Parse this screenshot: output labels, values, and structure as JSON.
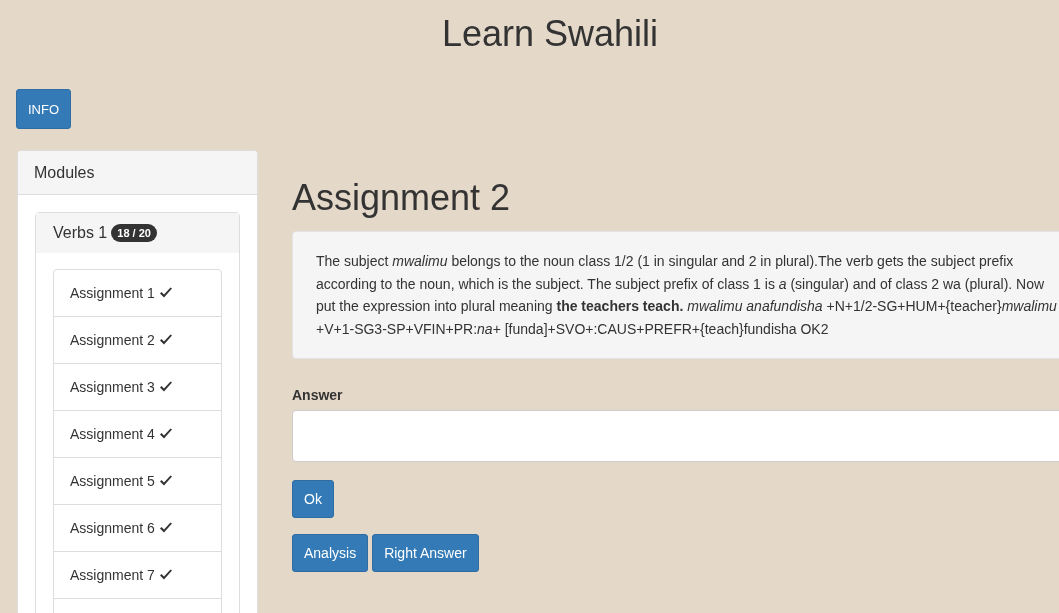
{
  "header": {
    "title": "Learn Swahili"
  },
  "info_button": "INFO",
  "sidebar": {
    "title": "Modules",
    "module": {
      "name": "Verbs 1",
      "badge": "18 / 20",
      "items": [
        {
          "label": "Assignment 1",
          "done": true
        },
        {
          "label": "Assignment 2",
          "done": true
        },
        {
          "label": "Assignment 3",
          "done": true
        },
        {
          "label": "Assignment 4",
          "done": true
        },
        {
          "label": "Assignment 5",
          "done": true
        },
        {
          "label": "Assignment 6",
          "done": true
        },
        {
          "label": "Assignment 7",
          "done": true
        }
      ]
    }
  },
  "main": {
    "heading": "Assignment 2",
    "description": "The subject *mwalimu* belongs to the noun class 1/2 (1 in singular and 2 in plural).The verb gets the subject prefix according to the noun, which is the subject. The subject prefix of class 1 is *a* (singular) and of class 2 wa (plural). Now put the expression into plural meaning **the teachers teach.** *mwalimu anafundisha* +N+1/2-SG+HUM+{teacher}*mwalimu* +V+1-SG3-SP+VFIN+PR:*na*+ [funda]+SVO+:CAUS+PREFR+{teach}fundisha OK2",
    "answer_label": "Answer",
    "ok_button": "Ok",
    "buttons": [
      "Analysis",
      "Right Answer"
    ]
  }
}
